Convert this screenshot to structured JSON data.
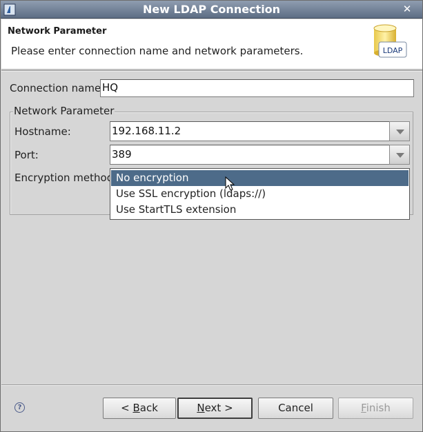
{
  "window": {
    "title": "New LDAP Connection"
  },
  "header": {
    "title": "Network Parameter",
    "description": "Please enter connection name and network parameters.",
    "icon_label": "LDAP"
  },
  "form": {
    "connection_name_label": "Connection name:",
    "connection_name_value": "HQ",
    "group_title": "Network Parameter",
    "hostname_label": "Hostname:",
    "hostname_value": "192.168.11.2",
    "port_label": "Port:",
    "port_value": "389",
    "encryption_label": "Encryption method:"
  },
  "encryption_dropdown": {
    "options": [
      "No encryption",
      "Use SSL encryption (ldaps://)",
      "Use StartTLS extension"
    ],
    "selected_index": 0
  },
  "buttons": {
    "back": {
      "pre": "< ",
      "mnemonic": "B",
      "post": "ack"
    },
    "next": {
      "pre": "",
      "mnemonic": "N",
      "post": "ext >"
    },
    "cancel": "Cancel",
    "finish": {
      "pre": "",
      "mnemonic": "F",
      "post": "inish"
    }
  },
  "help_icon_glyph": "?",
  "colors": {
    "selection": "#4d6b89",
    "titlebar": "#5d6d84"
  }
}
